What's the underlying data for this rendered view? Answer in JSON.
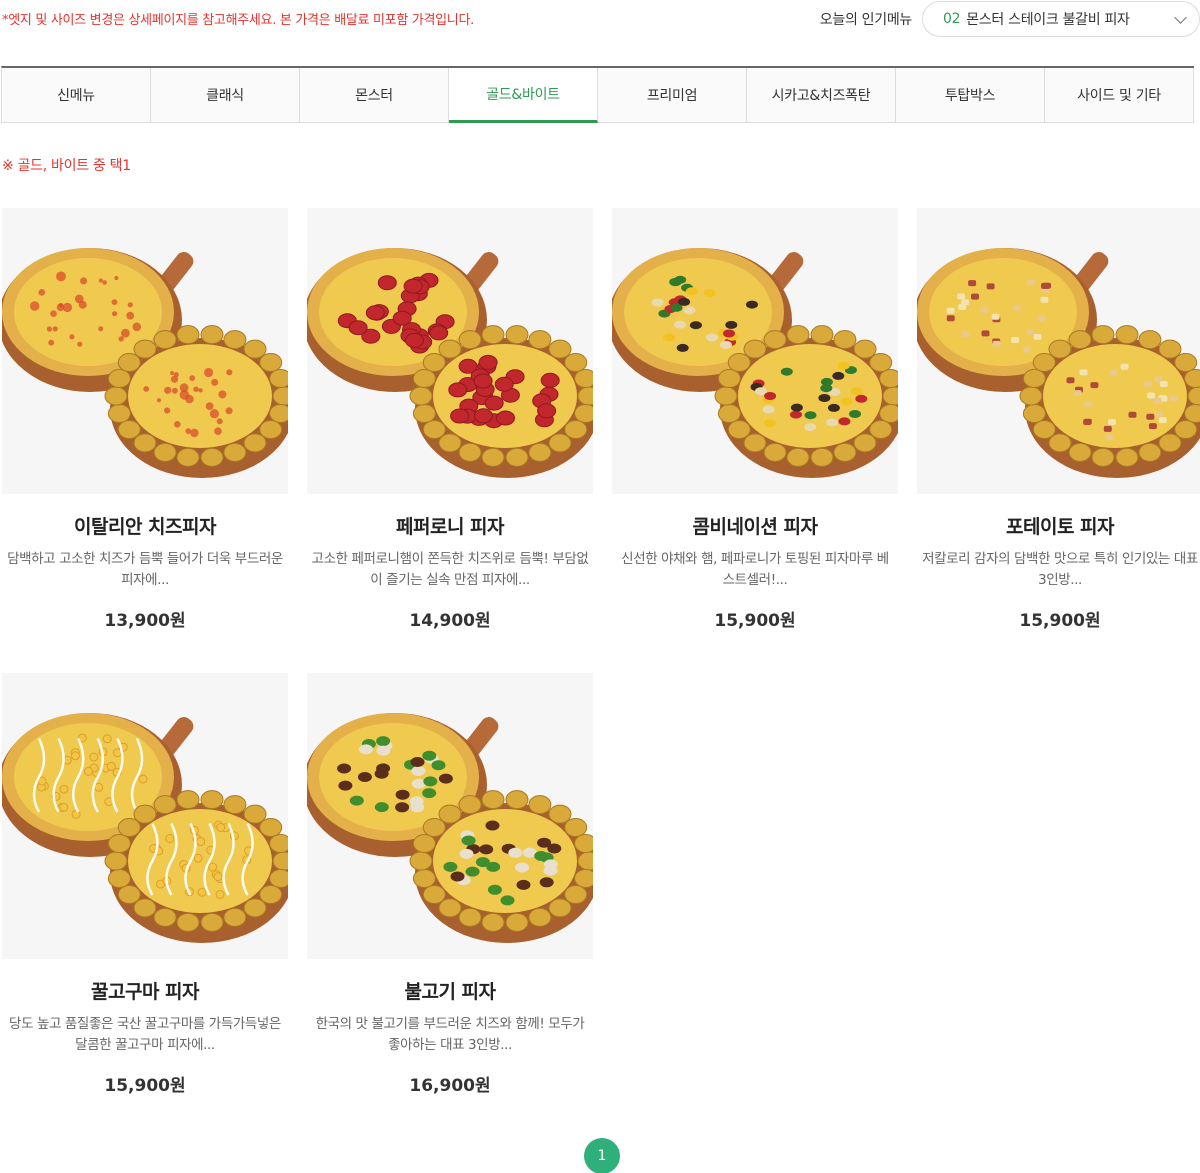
{
  "notice": "*엣지 및 사이즈 변경은 상세페이지를 참고해주세요. 본 가격은 배달료 미포함 가격입니다.",
  "popular": {
    "label": "오늘의 인기메뉴",
    "rank": "02",
    "name": "몬스터 스테이크 불갈비 피자"
  },
  "tabs": [
    {
      "label": "신메뉴",
      "active": false
    },
    {
      "label": "클래식",
      "active": false
    },
    {
      "label": "몬스터",
      "active": false
    },
    {
      "label": "골드&바이트",
      "active": true
    },
    {
      "label": "프리미엄",
      "active": false
    },
    {
      "label": "시카고&치즈폭탄",
      "active": false
    },
    {
      "label": "투탑박스",
      "active": false
    },
    {
      "label": "사이드 및 기타",
      "active": false
    }
  ],
  "subnote": "※ 골드, 바이트 중 택1",
  "products": [
    {
      "name": "이탈리안 치즈피자",
      "desc": "담백하고 고소한 치즈가 듬뿍 들어가 더욱 부드러운 피자에...",
      "price": "13,900원",
      "topping": "cheese"
    },
    {
      "name": "페퍼로니 피자",
      "desc": "고소한 페퍼로니햄이 쫀득한 치즈위로 듬뿍! 부담없이 즐기는 실속 만점 피자에...",
      "price": "14,900원",
      "topping": "pepperoni"
    },
    {
      "name": "콤비네이션 피자",
      "desc": "신선한 야채와 햄, 페파로니가 토핑된 피자마루 베스트셀러!...",
      "price": "15,900원",
      "topping": "combination"
    },
    {
      "name": "포테이토 피자",
      "desc": "저칼로리 감자의 담백한 맛으로 특히 인기있는 대표 3인방...",
      "price": "15,900원",
      "topping": "potato"
    },
    {
      "name": "꿀고구마 피자",
      "desc": "당도 높고 품질좋은 국산 꿀고구마를 가득가득넣은 달콤한 꿀고구마 피자에...",
      "price": "15,900원",
      "topping": "sweetpotato"
    },
    {
      "name": "불고기 피자",
      "desc": "한국의 맛 불고기를 부드러운 치즈와 함께! 모두가 좋아하는 대표 3인방...",
      "price": "16,900원",
      "topping": "bulgogi"
    }
  ],
  "pagination": {
    "current": "1"
  },
  "colors": {
    "accent": "#2f9a52",
    "notice": "#e8322d",
    "pager": "#2fb07a"
  }
}
